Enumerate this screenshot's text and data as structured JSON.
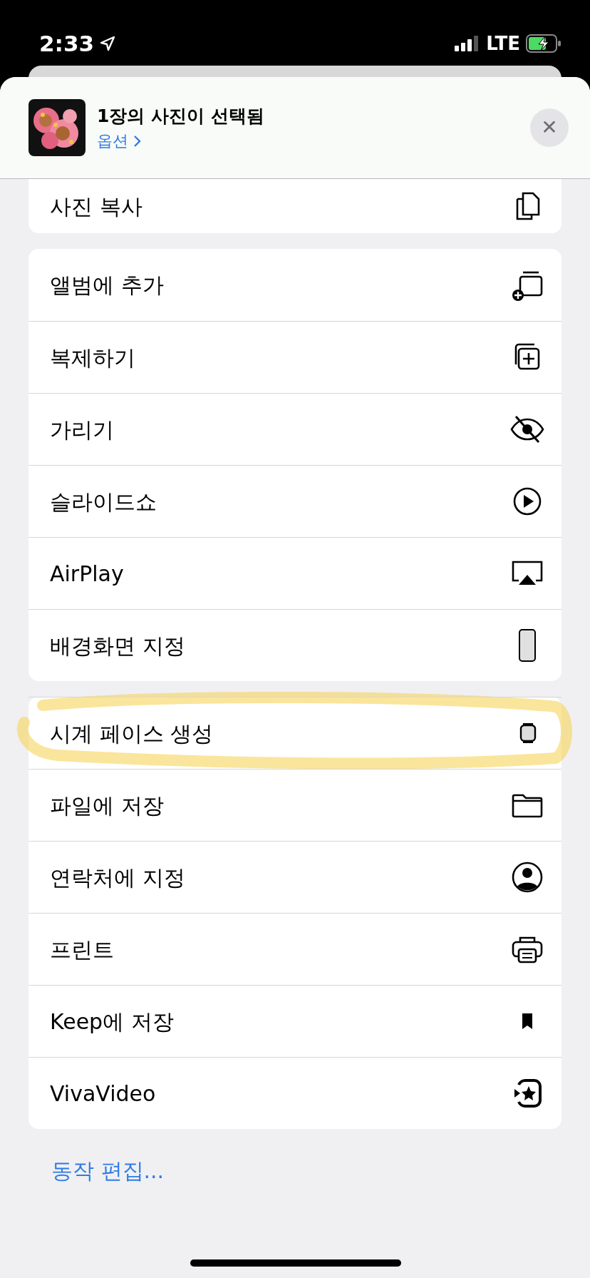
{
  "status_bar": {
    "time": "2:33",
    "network": "LTE"
  },
  "header": {
    "title": "1장의 사진이 선택됨",
    "options_link": "옵션",
    "close_button": "✕"
  },
  "groups": [
    {
      "rows": [
        {
          "label": "사진 복사",
          "highlighted": false
        }
      ]
    },
    {
      "rows": [
        {
          "label": "앨범에 추가",
          "highlighted": false
        },
        {
          "label": "복제하기",
          "highlighted": false
        },
        {
          "label": "가리기",
          "highlighted": false
        },
        {
          "label": "슬라이드쇼",
          "highlighted": false
        },
        {
          "label": "AirPlay",
          "highlighted": false
        },
        {
          "label": "배경화면 지정",
          "highlighted": false
        }
      ]
    },
    {
      "rows": [
        {
          "label": "시계 페이스 생성",
          "highlighted": true
        },
        {
          "label": "파일에 저장",
          "highlighted": false
        },
        {
          "label": "연락처에 지정",
          "highlighted": false
        },
        {
          "label": "프린트",
          "highlighted": false
        },
        {
          "label": "Keep에 저장",
          "highlighted": false
        },
        {
          "label": "VivaVideo",
          "highlighted": false
        }
      ]
    }
  ],
  "edit_actions_link": "동작 편집..."
}
